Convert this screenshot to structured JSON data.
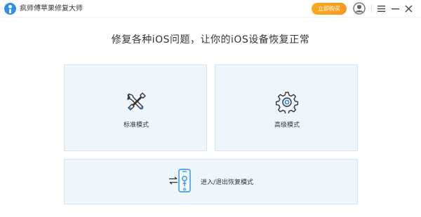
{
  "window": {
    "app_title": "疯师傅苹果修复大师",
    "buy_label": "立即购买"
  },
  "icons": {
    "logo": "app-logo-icon",
    "user": "user-avatar-icon",
    "menu": "menu-icon",
    "minimize": "minimize-icon",
    "close": "close-icon",
    "standard": "tools-icon",
    "advanced": "gear-icon",
    "recovery_arrows": "swap-arrows-icon",
    "recovery_phone": "phone-recovery-icon"
  },
  "colors": {
    "accent": "#2f8fe6",
    "buy_button": "#f8a91e",
    "card_background": "#eef6fc",
    "card_border": "#d3e3f0"
  },
  "main": {
    "headline": "修复各种iOS问题，让你的iOS设备恢复正常",
    "cards": [
      {
        "label": "标准模式"
      },
      {
        "label": "高级模式"
      },
      {
        "label": "进入/退出恢复模式"
      }
    ]
  }
}
